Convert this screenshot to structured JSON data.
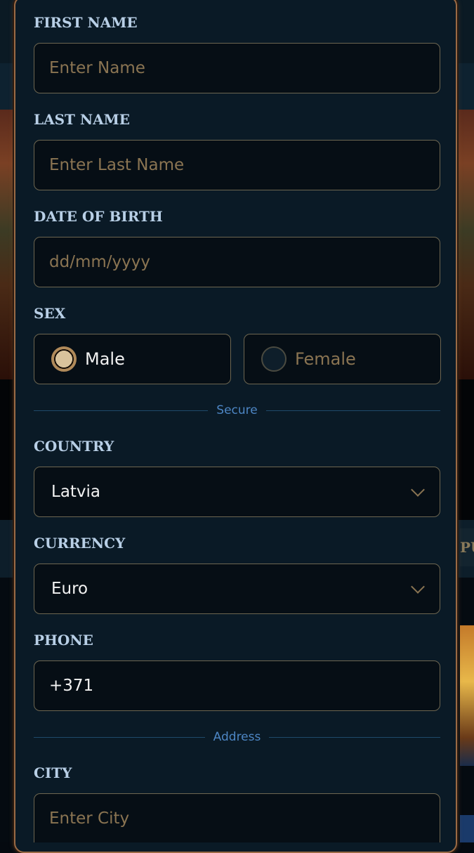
{
  "form": {
    "first_name": {
      "label": "FIRST NAME",
      "placeholder": "Enter Name"
    },
    "last_name": {
      "label": "LAST NAME",
      "placeholder": "Enter Last Name"
    },
    "dob": {
      "label": "DATE OF BIRTH",
      "placeholder": "dd/mm/yyyy"
    },
    "sex": {
      "label": "SEX",
      "options": [
        {
          "label": "Male",
          "selected": true
        },
        {
          "label": "Female",
          "selected": false
        }
      ]
    },
    "secure_divider": "Secure",
    "country": {
      "label": "COUNTRY",
      "value": "Latvia"
    },
    "currency": {
      "label": "CURRENCY",
      "value": "Euro"
    },
    "phone": {
      "label": "PHONE",
      "value": "+371"
    },
    "address_divider": "Address",
    "city": {
      "label": "CITY",
      "placeholder": "Enter City"
    }
  },
  "background": {
    "side_text": "PU"
  },
  "colors": {
    "panel_bg": "#0a1a26",
    "panel_border": "#9a6a45",
    "label": "#b8cfe6",
    "placeholder": "#8a7452",
    "divider_text": "#4d86c4"
  }
}
